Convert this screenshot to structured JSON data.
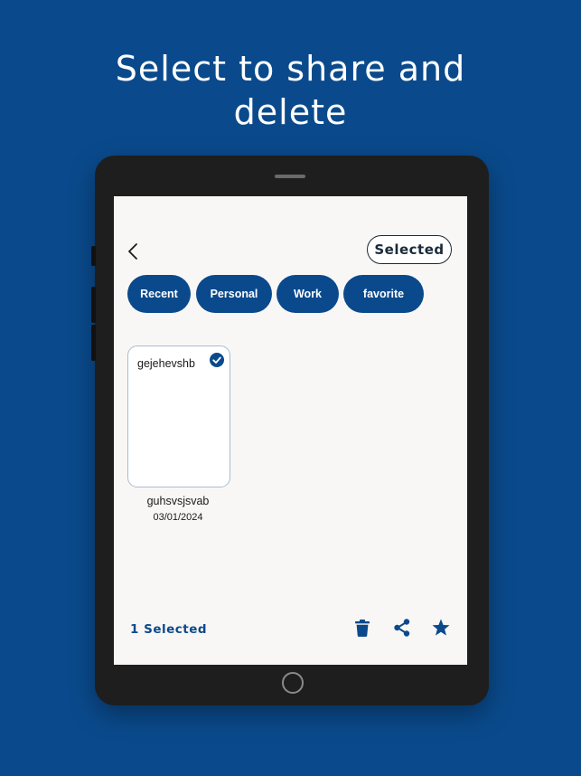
{
  "headline": {
    "line1": "Select to share and",
    "line2": "delete"
  },
  "header": {
    "selected_button": "Selected"
  },
  "chips": [
    "Recent",
    "Personal",
    "Work",
    "favorite"
  ],
  "note_card": {
    "title": "gejehevshb",
    "name": "guhsvsjsvab",
    "date": "03/01/2024",
    "checked": true
  },
  "bottom_bar": {
    "selection_count": "1 Selected",
    "actions": [
      "trash-icon",
      "share-icon",
      "star-icon"
    ]
  },
  "colors": {
    "brand": "#0a4a8c",
    "screen_bg": "#f9f7f5",
    "device": "#1e1e1e"
  }
}
